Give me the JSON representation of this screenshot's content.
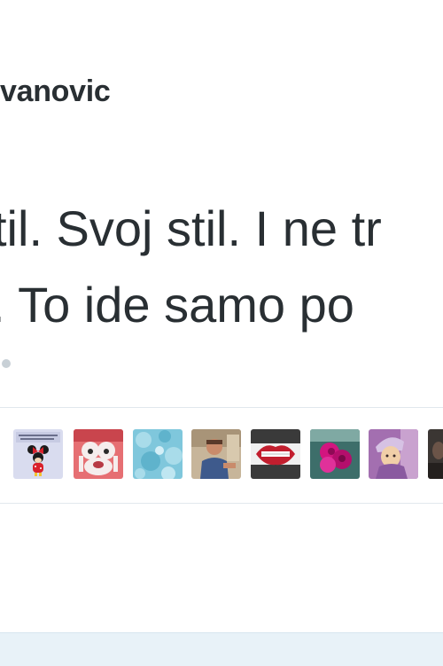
{
  "tweet": {
    "author_name_fragment": "vanovic",
    "text_lines": [
      "til. Svoj stil. I ne tr",
      ". To ide samo po"
    ]
  },
  "likers": {
    "avatars": [
      {
        "name": "minnie-mouse-avatar"
      },
      {
        "name": "cartoon-avatar"
      },
      {
        "name": "blue-pattern-avatar"
      },
      {
        "name": "person-photo-avatar"
      },
      {
        "name": "lips-avatar"
      },
      {
        "name": "pink-roses-avatar"
      },
      {
        "name": "woman-headscarf-avatar"
      },
      {
        "name": "dark-photo-avatar"
      }
    ]
  },
  "colors": {
    "text": "#292f33",
    "divider": "#e1e8ed",
    "bottom_bar": "#e8f2f8"
  }
}
